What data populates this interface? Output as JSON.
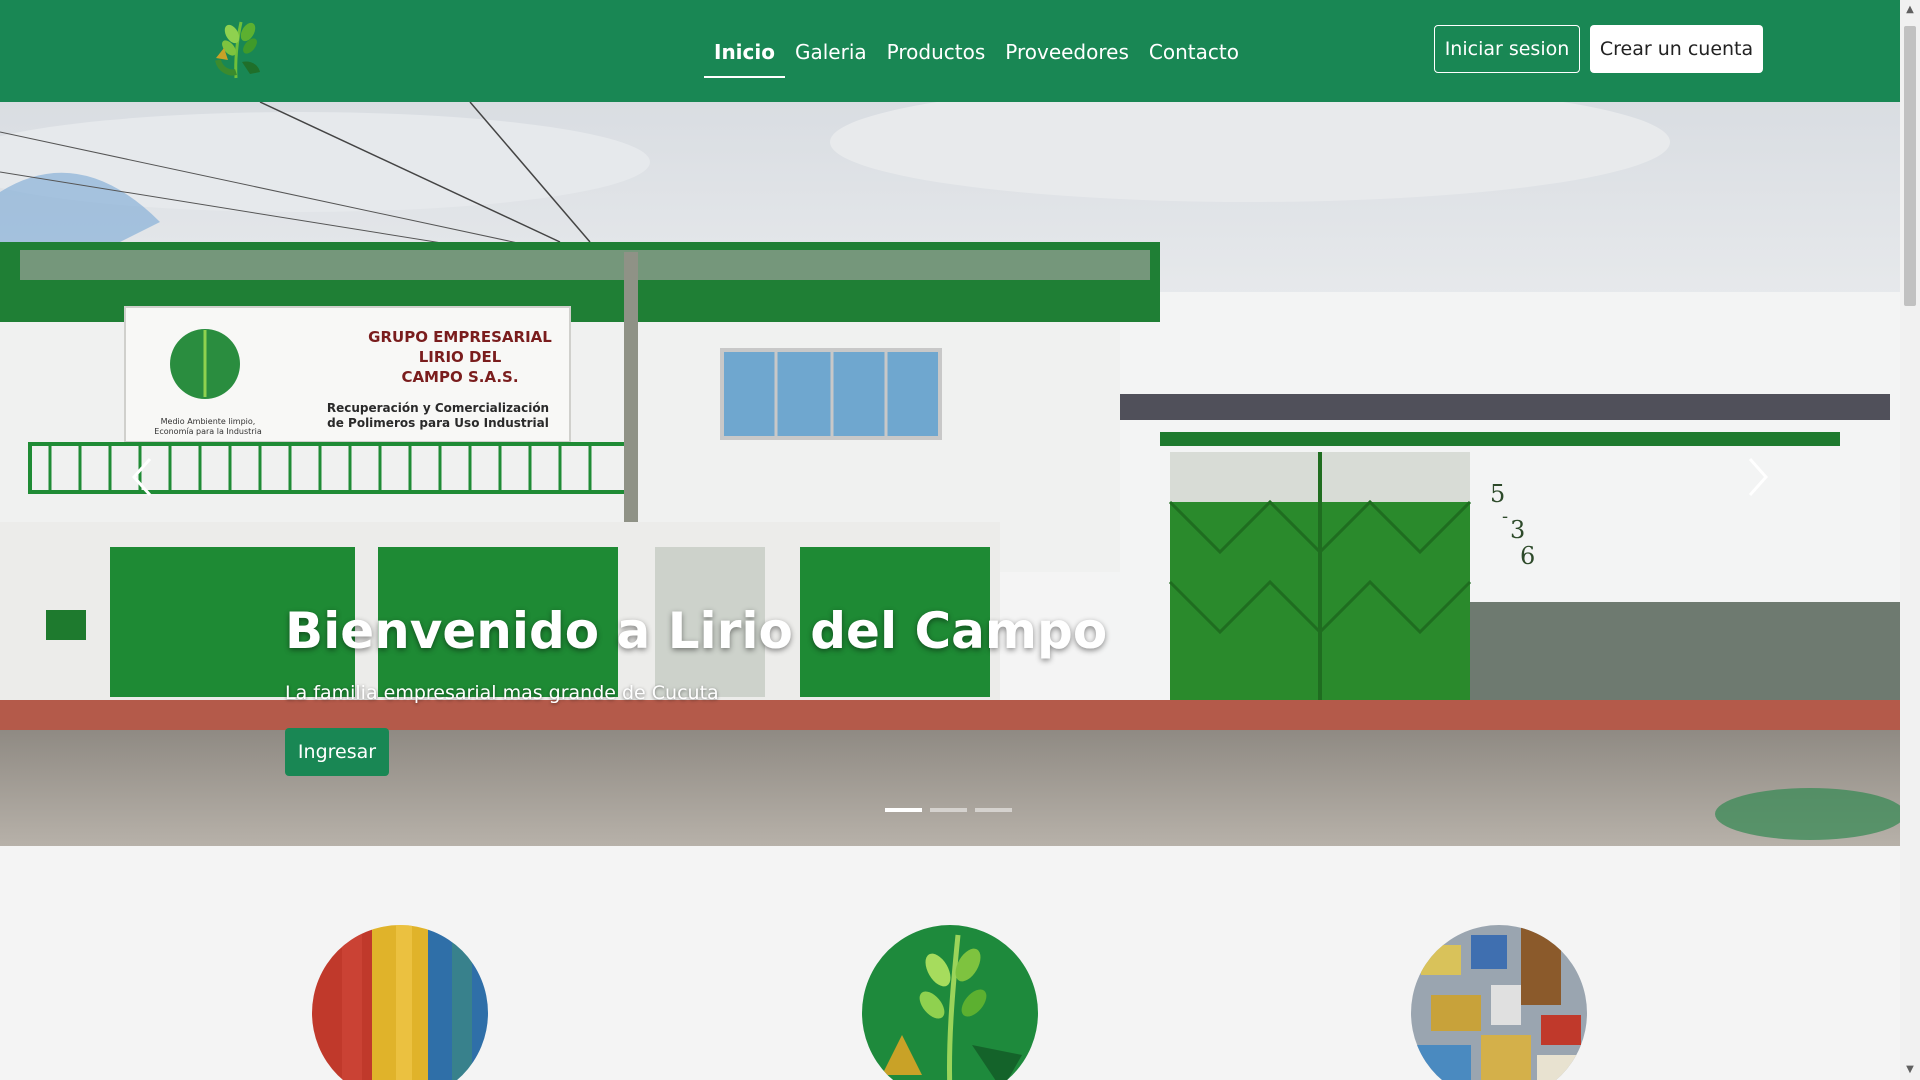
{
  "brand": {
    "logo_icon": "leaf-recycle-logo",
    "primary_color": "#198754"
  },
  "nav": {
    "links": [
      {
        "label": "Inicio",
        "active": true
      },
      {
        "label": "Galeria",
        "active": false
      },
      {
        "label": "Productos",
        "active": false
      },
      {
        "label": "Proveedores",
        "active": false
      },
      {
        "label": "Contacto",
        "active": false
      }
    ],
    "login_label": "Iniciar sesion",
    "signup_label": "Crear un cuenta"
  },
  "hero": {
    "title": "Bienvenido a Lirio del Campo",
    "subtitle": "La familia empresarial mas grande de Cucuta",
    "cta_label": "Ingresar",
    "prev_icon": "chevron-left-icon",
    "next_icon": "chevron-right-icon",
    "slide_count": 3,
    "active_slide": 1,
    "sign": {
      "title_lines": [
        "GRUPO EMPRESARIAL",
        "LIRIO DEL",
        "CAMPO S.A.S."
      ],
      "sub_lines": [
        "Recuperación y Comercialización",
        "de Polimeros para Uso Industrial"
      ],
      "motto_lines": [
        "Medio Ambiente limpio,",
        "Economía para la Industria"
      ]
    },
    "address_number": [
      "5",
      "-",
      "3",
      "6"
    ]
  },
  "features": [
    {
      "image": "colored-plastic-pellets"
    },
    {
      "image": "leaf-recycle-logo"
    },
    {
      "image": "baled-plastic-waste"
    }
  ]
}
